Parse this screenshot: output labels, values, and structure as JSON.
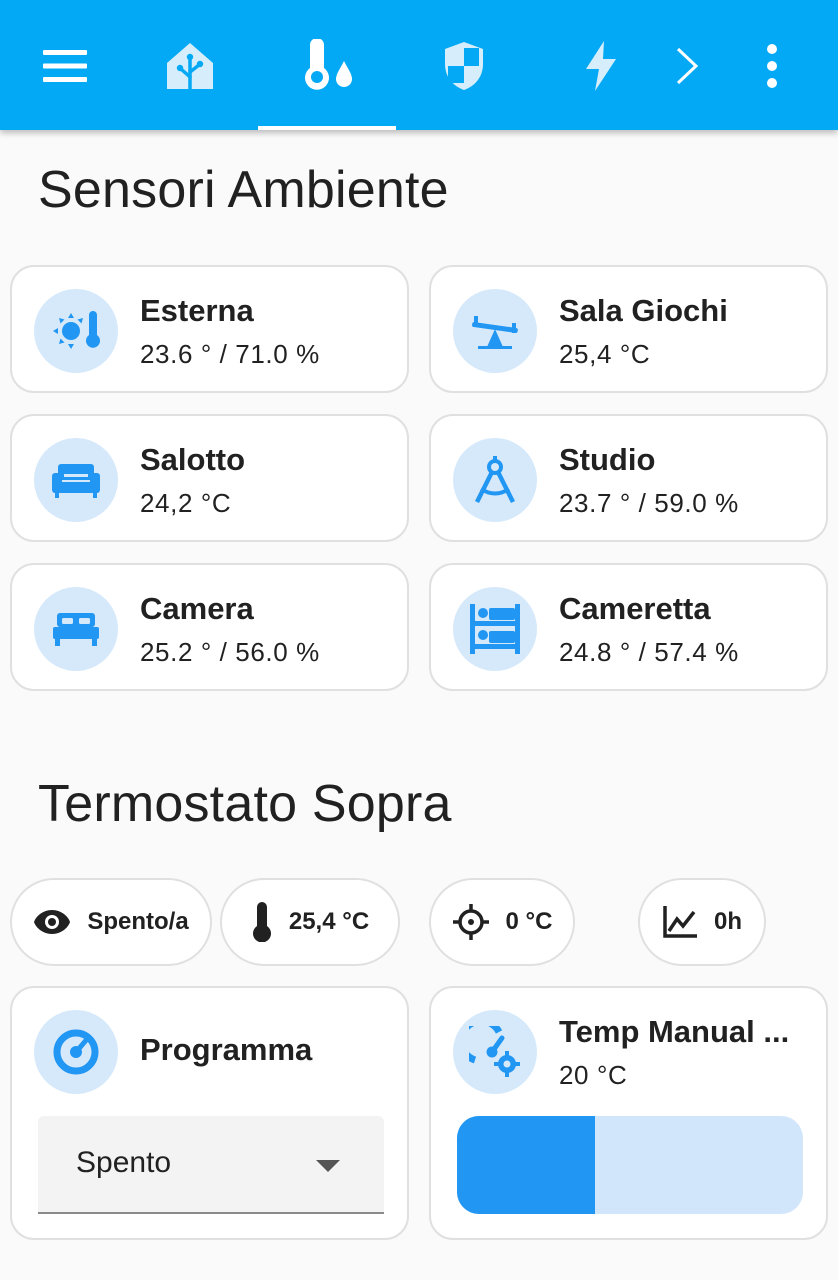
{
  "colors": {
    "header": "#03a9f4",
    "accent": "#2196f3",
    "icon_bg": "#d6e9fb",
    "background": "#fafafa"
  },
  "toolbar": {
    "icons": [
      "menu-icon",
      "home-assistant-icon",
      "thermometer-water-icon",
      "shield-home-icon",
      "lightning-bolt-icon",
      "chevron-right-icon",
      "dots-vertical-icon"
    ]
  },
  "sensors": {
    "title": "Sensori Ambiente",
    "tiles": [
      {
        "name": "Esterna",
        "state": "23.6 ° / 71.0 %",
        "icon": "sun-thermometer-icon"
      },
      {
        "name": "Sala Giochi",
        "state": "25,4 °C",
        "icon": "seesaw-icon"
      },
      {
        "name": "Salotto",
        "state": "24,2 °C",
        "icon": "sofa-icon"
      },
      {
        "name": "Studio",
        "state": "23.7 ° / 59.0 %",
        "icon": "compass-drafting-icon"
      },
      {
        "name": "Camera",
        "state": "25.2 ° / 56.0 %",
        "icon": "bed-icon"
      },
      {
        "name": "Cameretta",
        "state": "24.8 ° / 57.4 %",
        "icon": "bunk-bed-icon"
      }
    ]
  },
  "thermostat": {
    "title": "Termostato Sopra",
    "badges": [
      {
        "text": "Spento/a",
        "icon": "eye-icon"
      },
      {
        "text": "25,4 °C",
        "icon": "thermometer-icon"
      },
      {
        "text": "0 °C",
        "icon": "crosshairs-icon"
      },
      {
        "text": "0h",
        "icon": "chart-line-icon"
      }
    ],
    "program": {
      "name": "Programma",
      "select_value": "Spento",
      "icon": "gauge-icon"
    },
    "manual": {
      "name": "Temp Manual ...",
      "state": "20 °C",
      "icon": "gauge-cog-icon",
      "slider_fraction": 0.4
    }
  }
}
